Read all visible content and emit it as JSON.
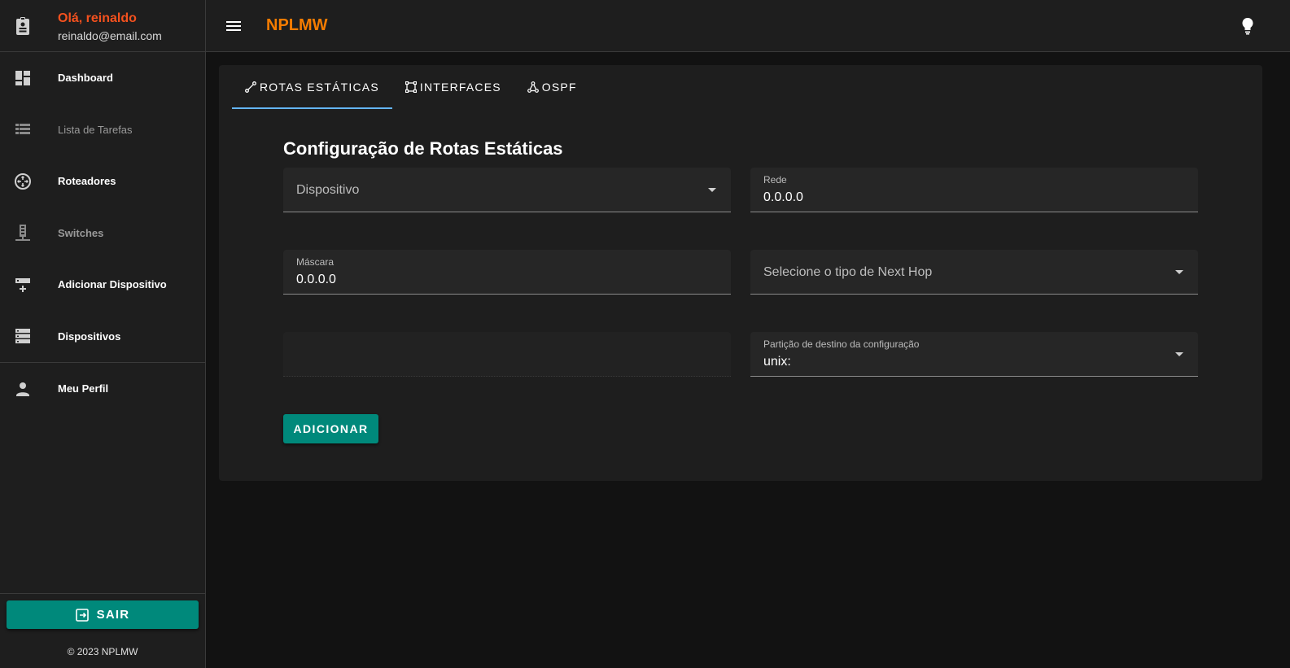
{
  "user": {
    "greeting": "Olá, reinaldo",
    "email": "reinaldo@email.com"
  },
  "sidebar": {
    "items": [
      {
        "label": "Dashboard",
        "icon": "dashboard-icon"
      },
      {
        "label": "Lista de Tarefas",
        "icon": "list-icon"
      },
      {
        "label": "Roteadores",
        "icon": "router-icon"
      },
      {
        "label": "Switches",
        "icon": "switch-icon"
      },
      {
        "label": "Adicionar Dispositivo",
        "icon": "add-device-icon"
      },
      {
        "label": "Dispositivos",
        "icon": "devices-icon"
      },
      {
        "label": "Meu Perfil",
        "icon": "person-icon"
      }
    ],
    "logout_label": "SAIR",
    "copyright": "© 2023 NPLMW"
  },
  "header": {
    "title": "NPLMW"
  },
  "tabs": [
    {
      "label": "ROTAS ESTÁTICAS",
      "icon": "route-icon",
      "active": true
    },
    {
      "label": "INTERFACES",
      "icon": "interfaces-icon",
      "active": false
    },
    {
      "label": "OSPF",
      "icon": "ospf-icon",
      "active": false
    }
  ],
  "form": {
    "title": "Configuração de Rotas Estáticas",
    "device_placeholder": "Dispositivo",
    "network_label": "Rede",
    "network_value": "0.0.0.0",
    "mask_label": "Máscara",
    "mask_value": "0.0.0.0",
    "next_hop_placeholder": "Selecione o tipo de Next Hop",
    "partition_label": "Partição de destino da configuração",
    "partition_value": "unix:",
    "submit_label": "ADICIONAR"
  },
  "colors": {
    "accent": "#00897b",
    "brand": "#f57c00",
    "greeting": "#f4511e",
    "tab_indicator": "#64b5f6"
  }
}
